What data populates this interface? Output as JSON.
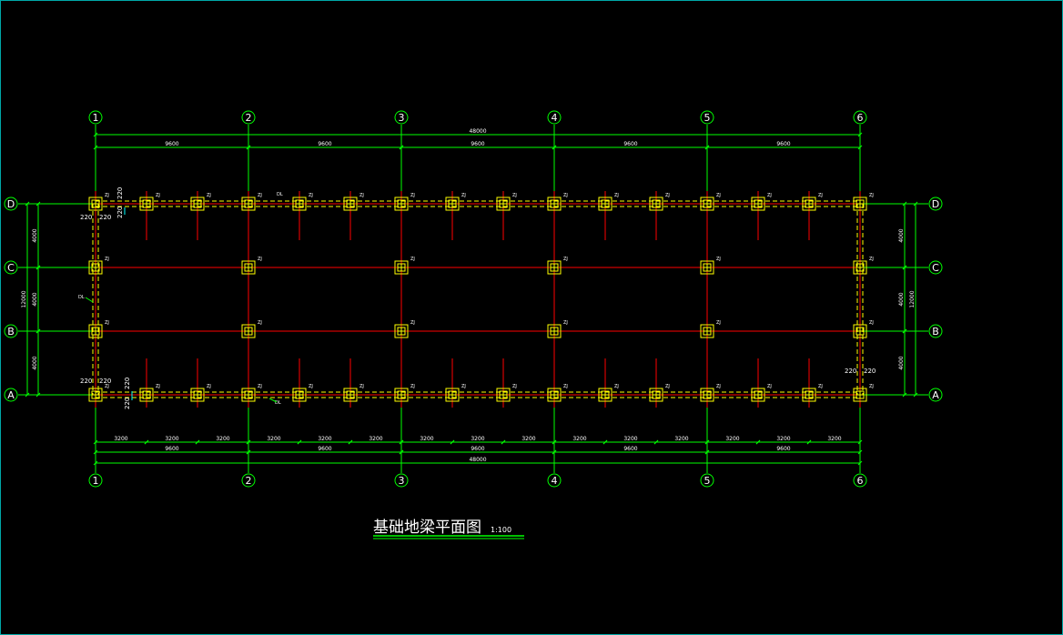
{
  "drawing": {
    "title": "基础地梁平面图",
    "scale": "1:100",
    "column_axes": [
      "1",
      "2",
      "3",
      "4",
      "5",
      "6"
    ],
    "row_axes": [
      "D",
      "C",
      "B",
      "A"
    ],
    "top_dims": {
      "total": "48000",
      "bays": [
        "9600",
        "9600",
        "9600",
        "9600",
        "9600"
      ]
    },
    "bottom_dims": {
      "subs": [
        "3200",
        "3200",
        "3200",
        "3200",
        "3200",
        "3200",
        "3200",
        "3200",
        "3200",
        "3200",
        "3200",
        "3200",
        "3200",
        "3200",
        "3200"
      ],
      "bays": [
        "9600",
        "9600",
        "9600",
        "9600",
        "9600"
      ],
      "total": "48000"
    },
    "left_dims": {
      "segs": [
        "4000",
        "4000",
        "4000"
      ],
      "total": "12000"
    },
    "right_dims": {
      "segs": [
        "4000",
        "4000",
        "4000"
      ],
      "total": "12000"
    },
    "pile_label": "ZJ",
    "beam_label": "DL",
    "offsets": {
      "a": "220",
      "b": "220"
    },
    "colors": {
      "axis": "#00ff00",
      "beam": "#ff0000",
      "pile": "#ffff00",
      "dim": "#00ff00",
      "text": "#ffffff",
      "title": "#ffffff",
      "frame": "#00a8a8",
      "accent": "#00ffff"
    }
  }
}
